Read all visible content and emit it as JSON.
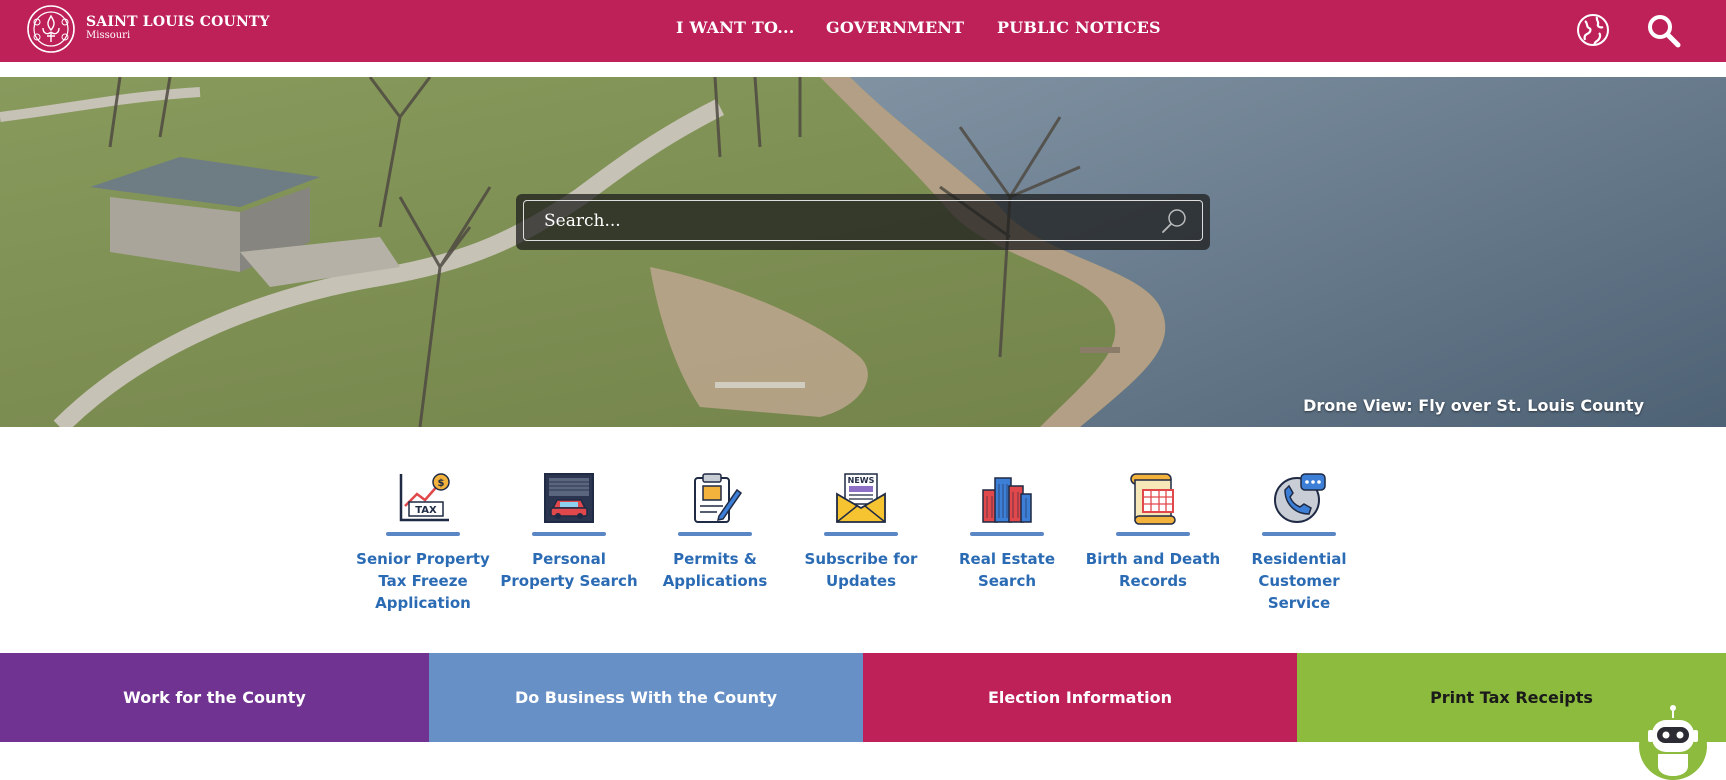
{
  "header": {
    "brand_title": "SAINT LOUIS COUNTY",
    "brand_subtitle": "Missouri",
    "nav": [
      {
        "label": "I WANT TO..."
      },
      {
        "label": "GOVERNMENT"
      },
      {
        "label": "PUBLIC NOTICES"
      }
    ],
    "icons": {
      "language": "globe-icon",
      "search": "search-icon"
    }
  },
  "hero": {
    "search_placeholder": "Search...",
    "caption": "Drone View: Fly over St. Louis County"
  },
  "quick_links": [
    {
      "label": "Senior Property Tax Freeze Application",
      "icon": "tax-chart-icon"
    },
    {
      "label": "Personal Property Search",
      "icon": "garage-car-icon"
    },
    {
      "label": "Permits & Applications",
      "icon": "clipboard-pen-icon"
    },
    {
      "label": "Subscribe for Updates",
      "icon": "news-envelope-icon"
    },
    {
      "label": "Real Estate Search",
      "icon": "buildings-icon"
    },
    {
      "label": "Birth and Death Records",
      "icon": "calendar-scroll-icon"
    },
    {
      "label": "Residential Customer Service",
      "icon": "phone-chat-icon"
    }
  ],
  "tiles": [
    {
      "label": "Work for the County"
    },
    {
      "label": "Do Business With the County"
    },
    {
      "label": "Election Information"
    },
    {
      "label": "Print Tax Receipts"
    }
  ],
  "colors": {
    "header": "#be2158",
    "link": "#2a6bb4",
    "tile_purple": "#713392",
    "tile_blue": "#6790c6",
    "tile_magenta": "#be2158",
    "tile_green": "#8cbb3e"
  },
  "chatbot": {
    "icon": "robot-chat-icon"
  }
}
